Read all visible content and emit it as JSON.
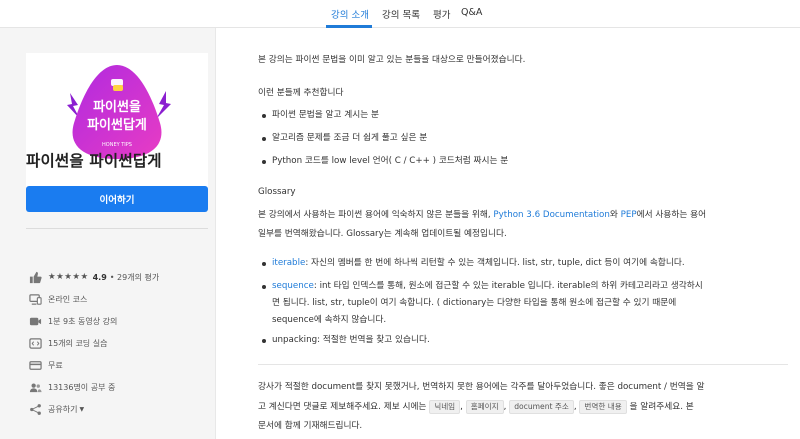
{
  "nav": {
    "tabs": [
      {
        "label": "강의 소개"
      },
      {
        "label": "강의 목록"
      },
      {
        "label": "평가"
      },
      {
        "label": "Q&A"
      }
    ]
  },
  "sidebar": {
    "thumbnail": {
      "line1": "파이썬을",
      "line2": "파이썬답게",
      "tagline": "HONEY TIPS"
    },
    "course_title": "파이썬을 파이썬답게",
    "continue_label": "이어하기",
    "rating": {
      "stars": "★★★★★",
      "score": "4.9",
      "count": "• 29개의 평가"
    },
    "meta": {
      "type": "온라인 코스",
      "duration": "1분 9초 동영상 강의",
      "quizzes": "15개의 코딩 실습",
      "price": "무료",
      "students": "13136명이 공부 중",
      "share": "공유하기"
    }
  },
  "main": {
    "intro": "본 강의는 파이썬 문법을 이미 알고 있는 분들을 대상으로 만들어졌습니다.",
    "recommend_heading": "이런 분들께 추천합니다",
    "recommend_items": [
      "파이썬 문법을 알고 계시는 분",
      "알고리즘 문제를 조금 더 쉽게 풀고 싶은 분",
      "Python 코드를 low level 언어( C / C++ ) 코드처럼 짜시는 분"
    ],
    "glossary_heading": "Glossary",
    "glossary_p1_a": "본 강의에서 사용하는 파이썬 용어에 익숙하지 않은 분들을 위해, ",
    "glossary_p1_link1": "Python 3.6 Documentation",
    "glossary_p1_b": "와 ",
    "glossary_p1_link2": "PEP",
    "glossary_p1_c": "에서 사용하는 용어",
    "glossary_p1_line2": "일부를 번역해왔습니다. Glossary는 계속해 업데이트될 예정입니다.",
    "terms": {
      "iterable_term": "iterable",
      "iterable_desc": ": 자신의 멤버를 한 번에 하나씩 리턴할 수 있는 객체입니다. list, str, tuple, dict 등이 여기에 속합니다.",
      "sequence_term": "sequence",
      "sequence_desc1": ": int 타입 인덱스를 통해, 원소에 접근할 수 있는 iterable 입니다. iterable의 하위 카테고리라고 생각하시",
      "sequence_desc2": "면 됩니다. list, str, tuple이 여기 속합니다. ( dictionary는 다양한 타입을 통해 원소에 접근할 수 있기 때문에",
      "sequence_desc3": "sequence에 속하지 않습니다.",
      "unpacking": "unpacking: 적절한 번역을 찾고 있습니다."
    },
    "footer_line1": "강사가 적절한 document를 찾지 못했거나, 번역하지 못한 용어에는 각주를 달아두었습니다. 좋은 document / 번역을 알",
    "footer_line2_a": "고 계신다면 댓글로 제보해주세요. 제보 시에는 ",
    "footer_chips": [
      "닉네임",
      "홈페이지",
      "document 주소",
      "번역한 내용"
    ],
    "footer_line2_b": " 을 알려주세요. 본",
    "footer_line3": "문서에 함께 기재해드립니다."
  },
  "colors": {
    "accent": "#1f7bd8",
    "button": "#1a7cf0",
    "thumb_purple": "#8b1fd0",
    "thumb_pink": "#e83cc4"
  }
}
